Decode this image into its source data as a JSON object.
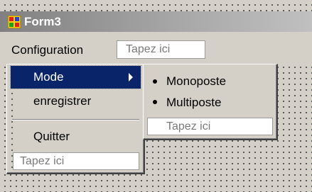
{
  "window": {
    "title": "Form3",
    "icon": "form-app-icon"
  },
  "menubar": {
    "items": [
      {
        "label": "Configuration"
      }
    ],
    "type_here": "Tapez ici"
  },
  "dropdown": {
    "items": [
      {
        "label": "Mode",
        "highlighted": true,
        "has_submenu": true,
        "icon": "submenu-arrow-icon"
      },
      {
        "label": "enregistrer"
      },
      {
        "label": "Quitter"
      }
    ],
    "type_here": "Tapez ici"
  },
  "submenu": {
    "items": [
      {
        "label": "Monoposte",
        "icon": "bullet-icon"
      },
      {
        "label": "Multiposte",
        "icon": "bullet-icon"
      }
    ],
    "type_here": "Tapez ici"
  },
  "colors": {
    "highlight": "#0a246a",
    "face": "#d4d0c8",
    "titlebar_inactive": "#808080",
    "placeholder_text": "#7a7a7a"
  }
}
